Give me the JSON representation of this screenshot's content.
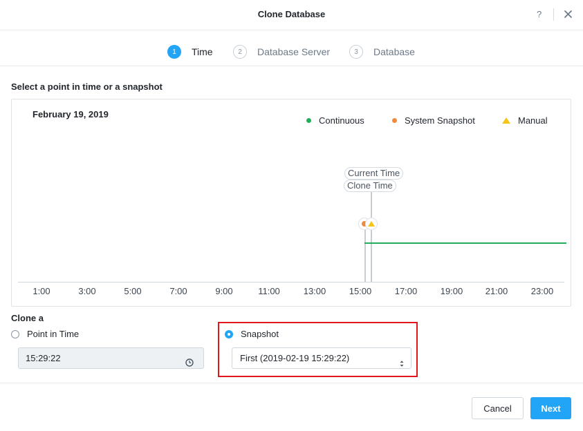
{
  "header": {
    "title": "Clone Database",
    "help_label": "?",
    "close_icon": "close-icon"
  },
  "steps": [
    {
      "num": "1",
      "label": "Time",
      "state": "active"
    },
    {
      "num": "2",
      "label": "Database Server",
      "state": "inactive"
    },
    {
      "num": "3",
      "label": "Database",
      "state": "inactive"
    }
  ],
  "section_label": "Select a point in time or a snapshot",
  "timeline": {
    "date": "February 19, 2019",
    "legend": [
      {
        "label": "Continuous",
        "shape": "dot",
        "color": "#1fae5b"
      },
      {
        "label": "System Snapshot",
        "shape": "dot",
        "color": "#f08a3a"
      },
      {
        "label": "Manual",
        "shape": "triangle",
        "color": "#f5c518"
      }
    ],
    "ticks": [
      "1:00",
      "3:00",
      "5:00",
      "7:00",
      "9:00",
      "11:00",
      "13:00",
      "15:00",
      "17:00",
      "19:00",
      "21:00",
      "23:00"
    ],
    "current_time_label": "Current Time",
    "clone_time_label": "Clone Time",
    "continuous_color": "#1fae5b"
  },
  "clone_a": {
    "label": "Clone a",
    "options": [
      {
        "label": "Point in Time",
        "selected": false
      },
      {
        "label": "Snapshot",
        "selected": true
      }
    ],
    "time_value": "15:29:22",
    "snapshot_value": "First (2019-02-19 15:29:22)"
  },
  "footer": {
    "cancel_label": "Cancel",
    "next_label": "Next"
  },
  "colors": {
    "accent": "#22a5f7",
    "highlight": "#e0161b"
  }
}
